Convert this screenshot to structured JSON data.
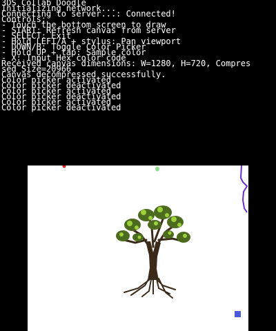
{
  "app": {
    "title": "3DS Collab Doodle"
  },
  "console": {
    "text_color": "#ffffff",
    "lines": [
      "3DS Collab Doodle",
      "Initializing network...",
      "Connecting to server...: Connected!",
      "Controls:",
      "- Touch the bottom screen to draw",
      "- START: Refresh canvas from server",
      "- SELECT: Exit",
      "- Hold LEFT/A + stylus: Pan viewport",
      "- DOWN/B: Toggle Color Picker",
      "- Hold UP + tap: Sample color",
      "- X: Input Hex color code",
      "Received canvas dimensions: W=1280, H=720, Compres",
      "sed Size=20966",
      "Canvas decompressed successfully.",
      "Color picker activated",
      "Color picker deactivated",
      "Color picker activated",
      "Color picker deactivated",
      "Color picker activated",
      "Color picker deactivated"
    ]
  },
  "canvas": {
    "background": "#ffffff",
    "stroke_colors": {
      "red_dot": "#e02020",
      "green_dot": "#8de08d",
      "purple_line": "#6a2fd0",
      "blue_square": "#4a5ad8",
      "tree_trunk": "#3b2a1a",
      "tree_leaves_dark": "#4d6b1f",
      "tree_leaves_light": "#9ccf3a"
    }
  }
}
